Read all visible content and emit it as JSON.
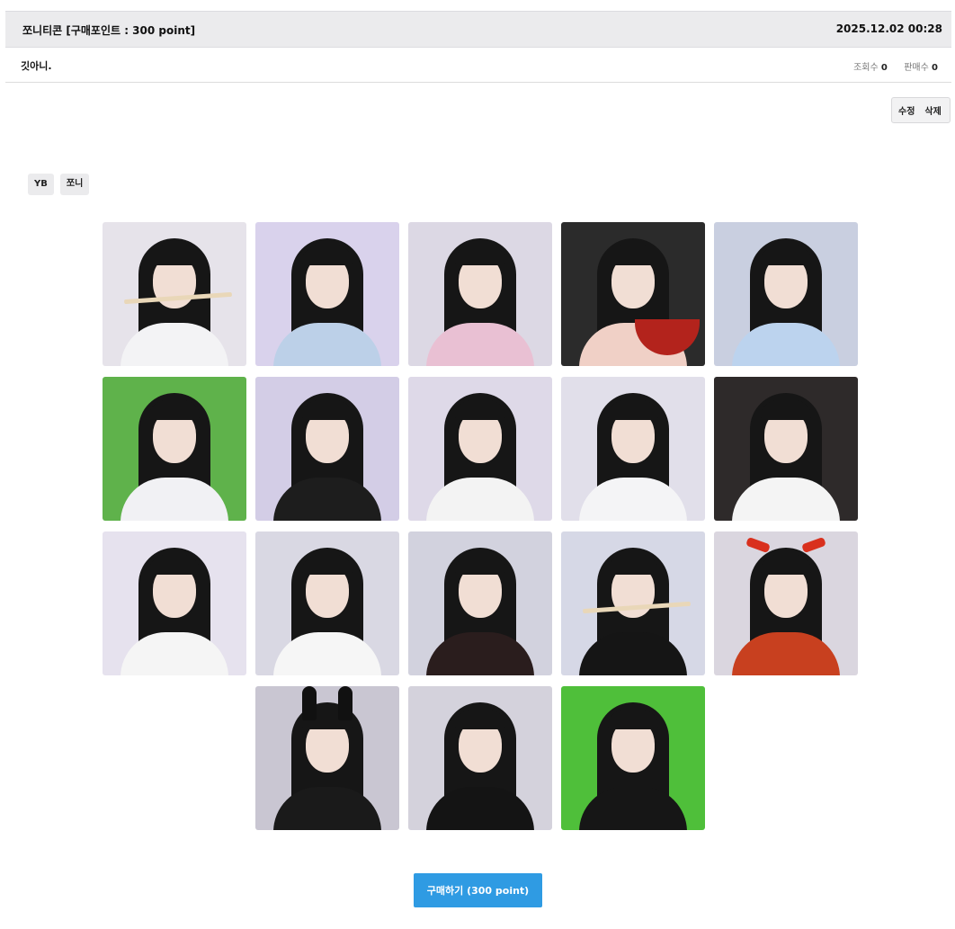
{
  "header": {
    "title": "쪼니티콘 [구매포인트 : 300 point]",
    "datetime": "2025.12.02 00:28"
  },
  "info": {
    "subtitle": "깃아니.",
    "views_label": "조회수",
    "views_value": "0",
    "sales_label": "판매수",
    "sales_value": "0"
  },
  "actions": {
    "edit_label": "수정",
    "delete_label": "삭제"
  },
  "tags": [
    "YB",
    "쪼니"
  ],
  "buy_button_label": "구매하기 (300 point)",
  "thumbnails": [
    {
      "bg": "#e6e3ea",
      "cloth": "#f3f3f5",
      "prop": "flute"
    },
    {
      "bg": "#d9d2ec",
      "cloth": "#bcd0e8",
      "prop": "none"
    },
    {
      "bg": "#dcd8e4",
      "cloth": "#e9c0d3",
      "prop": "none"
    },
    {
      "bg": "#2b2b2b",
      "cloth": "#f0d0c6",
      "prop": "bowl"
    },
    {
      "bg": "#c9cfe0",
      "cloth": "#bcd3ee",
      "prop": "none"
    },
    {
      "bg": "#5fb24b",
      "cloth": "#f1f1f4",
      "prop": "none"
    },
    {
      "bg": "#d3cde6",
      "cloth": "#1d1d1d",
      "prop": "none"
    },
    {
      "bg": "#ded9e8",
      "cloth": "#f3f3f3",
      "prop": "none"
    },
    {
      "bg": "#e1dfea",
      "cloth": "#f4f4f6",
      "prop": "none"
    },
    {
      "bg": "#2e2a2a",
      "cloth": "#f4f4f4",
      "prop": "none"
    },
    {
      "bg": "#e6e2ee",
      "cloth": "#f5f5f5",
      "prop": "none"
    },
    {
      "bg": "#d9d8e3",
      "cloth": "#f6f6f6",
      "prop": "none"
    },
    {
      "bg": "#d2d2de",
      "cloth": "#2a1d1d",
      "prop": "none"
    },
    {
      "bg": "#d6d8e6",
      "cloth": "#151515",
      "prop": "flute"
    },
    {
      "bg": "#dad6df",
      "cloth": "#c8401f",
      "prop": "antlers"
    },
    {
      "bg": "#c9c6d2",
      "cloth": "#1a1a1a",
      "prop": "ears"
    },
    {
      "bg": "#d4d2dc",
      "cloth": "#141414",
      "prop": "none"
    },
    {
      "bg": "#4fbf3a",
      "cloth": "#161616",
      "prop": "none"
    }
  ]
}
